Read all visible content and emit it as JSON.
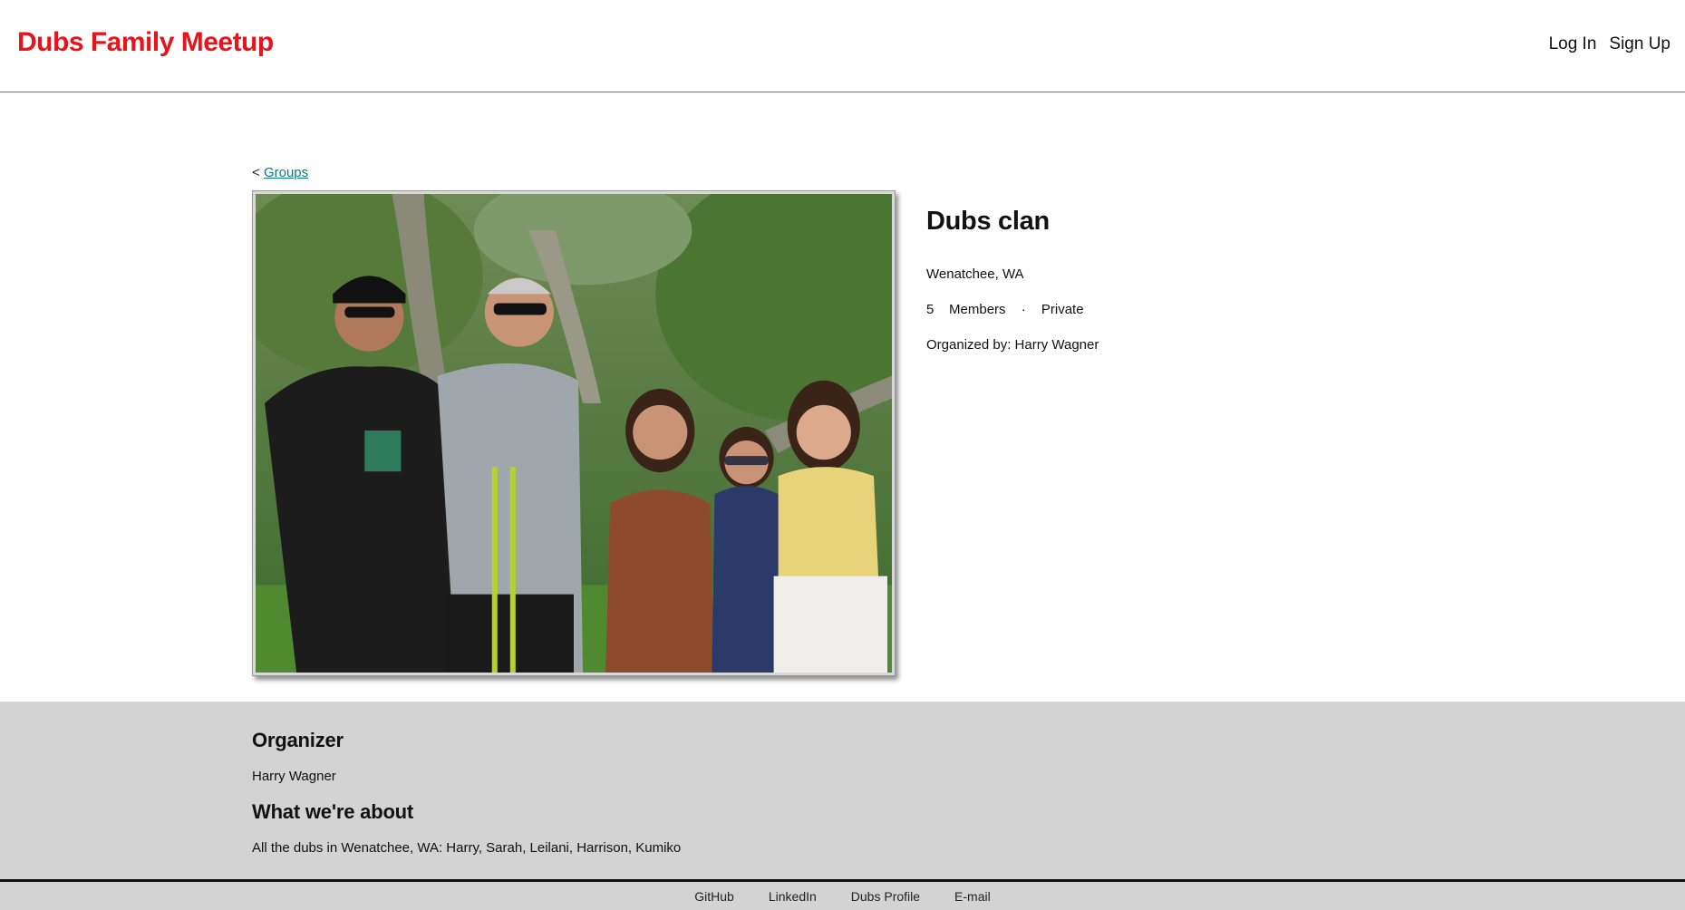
{
  "header": {
    "brand": "Dubs Family Meetup",
    "nav": {
      "login": "Log In",
      "signup": "Sign Up"
    }
  },
  "breadcrumb": {
    "prefix": "<",
    "link": "Groups"
  },
  "group": {
    "name": "Dubs clan",
    "location": "Wenatchee, WA",
    "member_count": "5",
    "members_label": "Members",
    "separator": "·",
    "privacy": "Private",
    "organized_by": "Organized by: Harry Wagner"
  },
  "details": {
    "organizer_heading": "Organizer",
    "organizer_name": "Harry Wagner",
    "about_heading": "What we're about",
    "about_text": "All the dubs in Wenatchee, WA: Harry, Sarah, Leilani, Harrison, Kumiko"
  },
  "footer": {
    "links": [
      "GitHub",
      "LinkedIn",
      "Dubs Profile",
      "E-mail"
    ]
  }
}
